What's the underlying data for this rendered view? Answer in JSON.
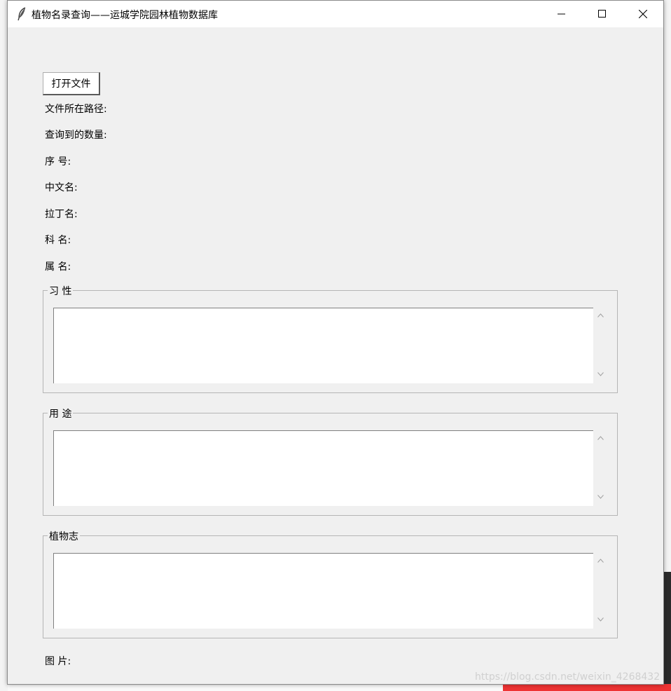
{
  "window": {
    "title": "植物名录查询——运城学院园林植物数据库"
  },
  "toolbar": {
    "open_file_label": "打开文件"
  },
  "fields": {
    "file_path": "文件所在路径:",
    "query_count": "查询到的数量:",
    "serial_no": "序  号:",
    "chinese_name": "中文名:",
    "latin_name": "拉丁名:",
    "family": "科  名:",
    "genus": "属  名:",
    "image": "图  片:"
  },
  "sections": {
    "habit": "习 性",
    "usage": "用 途",
    "flora": "植物志"
  },
  "background": {
    "watermark": "https://blog.csdn.net/weixin_4268432"
  },
  "icons": {
    "app": "feather-icon",
    "minimize": "minimize-icon",
    "maximize": "maximize-icon",
    "close": "close-icon"
  }
}
